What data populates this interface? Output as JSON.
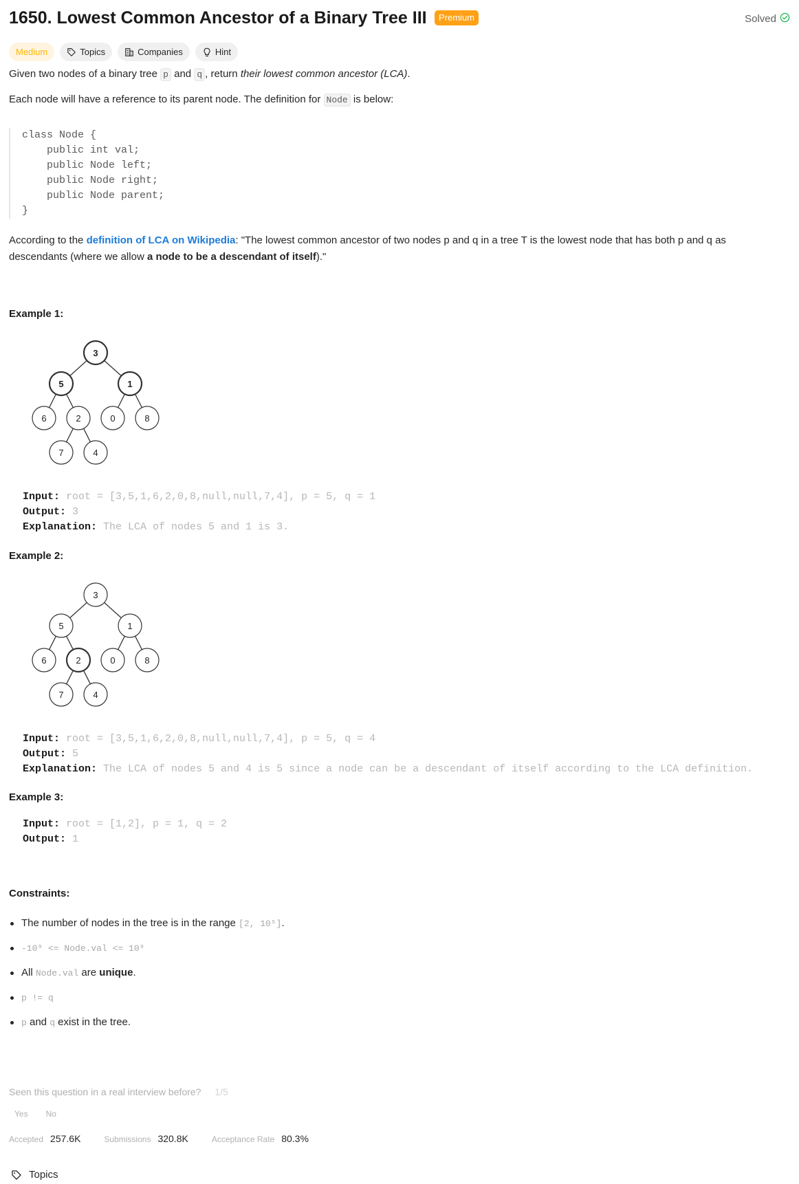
{
  "header": {
    "title": "1650. Lowest Common Ancestor of a Binary Tree III",
    "premium_badge": "Premium",
    "solved_label": "Solved"
  },
  "chips": {
    "difficulty": "Medium",
    "topics": "Topics",
    "companies": "Companies",
    "hint": "Hint"
  },
  "description": {
    "p1_a": "Given two nodes of a binary tree ",
    "p1_p": "p",
    "p1_b": " and ",
    "p1_q": "q",
    "p1_c": ", return ",
    "p1_d": "their lowest common ancestor (LCA)",
    "p1_e": ".",
    "p2_a": "Each node will have a reference to its parent node. The definition for ",
    "p2_code": "Node",
    "p2_b": " is below:",
    "code": "class Node {\n    public int val;\n    public Node left;\n    public Node right;\n    public Node parent;\n}",
    "p3_a": "According to the ",
    "p3_link": "definition of LCA on Wikipedia",
    "p3_b": ": \"The lowest common ancestor of two nodes p and q in a tree T is the lowest node that has both p and q as descendants (where we allow ",
    "p3_bold": "a node to be a descendant of itself",
    "p3_c": ").\""
  },
  "tree_nodes": [
    "3",
    "5",
    "1",
    "6",
    "2",
    "0",
    "8",
    "7",
    "4"
  ],
  "examples": [
    {
      "heading": "Example 1:",
      "input_label": "Input:",
      "input_value": " root = [3,5,1,6,2,0,8,null,null,7,4], p = 5, q = 1",
      "output_label": "Output:",
      "output_value": " 3",
      "explanation_label": "Explanation:",
      "explanation_value": " The LCA of nodes 5 and 1 is 3."
    },
    {
      "heading": "Example 2:",
      "input_label": "Input:",
      "input_value": " root = [3,5,1,6,2,0,8,null,null,7,4], p = 5, q = 4",
      "output_label": "Output:",
      "output_value": " 5",
      "explanation_label": "Explanation:",
      "explanation_value": " The LCA of nodes 5 and 4 is 5 since a node can be a descendant of itself according to the LCA definition."
    },
    {
      "heading": "Example 3:",
      "input_label": "Input:",
      "input_value": " root = [1,2], p = 1, q = 2",
      "output_label": "Output:",
      "output_value": " 1"
    }
  ],
  "constraints": {
    "heading": "Constraints:",
    "c1_a": "The number of nodes in the tree is in the range ",
    "c1_code": "[2, 10⁵]",
    "c1_b": ".",
    "c2_code": "-10⁹ <= Node.val <= 10⁹",
    "c3_a": "All ",
    "c3_code": "Node.val",
    "c3_b": " are ",
    "c3_bold": "unique",
    "c3_c": ".",
    "c4_code": "p != q",
    "c5_p": "p",
    "c5_a": " and ",
    "c5_q": "q",
    "c5_b": " exist in the tree."
  },
  "feedback": {
    "question": "Seen this question in a real interview before?",
    "count": "1/5",
    "yes": "Yes",
    "no": "No"
  },
  "stats": {
    "accepted_label": "Accepted",
    "accepted_value": "257.6K",
    "submissions_label": "Submissions",
    "submissions_value": "320.8K",
    "rate_label": "Acceptance Rate",
    "rate_value": "80.3%"
  },
  "footer": {
    "topics": "Topics"
  },
  "colors": {
    "accent_orange": "#ffa116",
    "solved_green": "#2cbb5d",
    "link_blue": "#1d7bd9"
  }
}
